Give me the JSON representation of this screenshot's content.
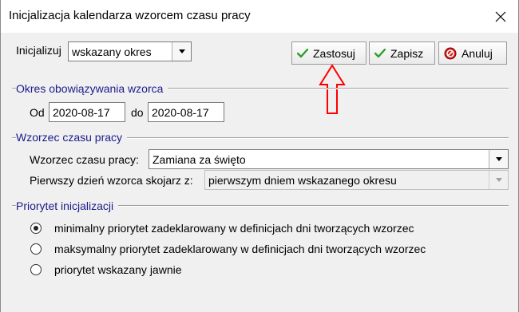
{
  "window": {
    "title": "Inicjalizacja kalendarza wzorcem czasu pracy"
  },
  "toolbar": {
    "init_label": "Inicjalizuj",
    "init_value": "wskazany okres",
    "apply_label": "Zastosuj",
    "save_label": "Zapisz",
    "cancel_label": "Anuluj"
  },
  "period": {
    "title": "Okres obowiązywania wzorca",
    "from_label": "Od",
    "from_value": "2020-08-17",
    "to_label": "do",
    "to_value": "2020-08-17"
  },
  "pattern": {
    "title": "Wzorzec czasu pracy",
    "pattern_label": "Wzorzec czasu pracy:",
    "pattern_value": "Zamiana za święto",
    "first_day_label": "Pierwszy dzień wzorca skojarz z:",
    "first_day_value": "pierwszym dniem wskazanego okresu"
  },
  "priority": {
    "title": "Priorytet inicjalizacji",
    "options": [
      {
        "label": "minimalny priorytet zadeklarowany w definicjach dni tworzących wzorzec",
        "checked": true
      },
      {
        "label": "maksymalny priorytet zadeklarowany w definicjach dni tworzących wzorzec",
        "checked": false
      },
      {
        "label": "priorytet wskazany jawnie",
        "checked": false
      }
    ]
  },
  "icons": {
    "close": "close-icon",
    "check": "check-icon",
    "cancel": "cancel-icon",
    "dropdown": "triangle-down-icon",
    "annotation_arrow": "up-arrow-annotation"
  },
  "colors": {
    "section_title": "#1a1a8c",
    "check_green": "#2e9e2e",
    "cancel_red": "#d02020",
    "annotation_red": "#ff0000"
  }
}
